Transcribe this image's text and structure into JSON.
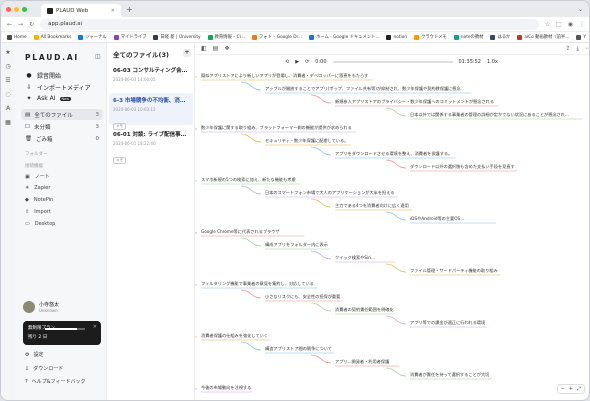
{
  "browser": {
    "tab_title": "PLAUD Web",
    "url": "app.plaud.ai",
    "bookmarks": [
      "Home",
      "All Bookmarks",
      "ジャーナル",
      "マイドライブ",
      "日経 新 | University",
      "教育情報 – Ci...",
      "フォト – Google Dr...",
      "ホーム - Google ドキュメント...",
      "notion",
      "クラウドメモ",
      "noteの教材",
      "はるか",
      "aiCo 動画教材（前半...",
      "Y",
      "小学生ボス",
      "Remote",
      "Amazon Photos",
      "ブログ Amazon Photos",
      "ニクアス Stu...",
      "LINE OA MANAGER",
      "確認ボタン登録"
    ],
    "bookmark_colors": [
      "#4a4a4a",
      "#f2b400",
      "#1a73e8",
      "#8e44ad",
      "#2c3e50",
      "#1aa260",
      "#e67e22",
      "#1a73e8",
      "#222222",
      "#ff9800",
      "#16a085",
      "#34495e",
      "#c0392b",
      "#555555",
      "#e74c3c",
      "#2980b9",
      "#f39c12",
      "#f39c12",
      "#27ae60",
      "#06c755",
      "#7f8c8d"
    ]
  },
  "sidebar": {
    "logo": "PLAUD.AI",
    "menu": [
      {
        "icon": "mic-icon",
        "glyph": "●",
        "label": "録音開始"
      },
      {
        "icon": "import-icon",
        "glyph": "⇩",
        "label": "インポートメディア"
      },
      {
        "icon": "ai-icon",
        "glyph": "✦",
        "label": "Ask AI",
        "badge": "New"
      }
    ],
    "nav": [
      {
        "icon": "file-icon",
        "glyph": "▤",
        "label": "全てのファイル",
        "count": "3",
        "active": true
      },
      {
        "icon": "uncategorized-icon",
        "glyph": "☐",
        "label": "未分類",
        "count": "3",
        "active": false
      },
      {
        "icon": "trash-icon",
        "glyph": "🗑",
        "label": "ごみ箱",
        "count": "0",
        "active": false
      }
    ],
    "folder_label": "フォルダー",
    "integration_label": "接続機能",
    "integrations": [
      {
        "icon": "note-icon",
        "glyph": "▣",
        "label": "ノート"
      },
      {
        "icon": "zapier-icon",
        "glyph": "✳",
        "label": "Zapier"
      },
      {
        "icon": "notepin-icon",
        "glyph": "◆",
        "label": "NotePin"
      },
      {
        "icon": "import-doc-icon",
        "glyph": "⇪",
        "label": "Import"
      },
      {
        "icon": "desktop-icon",
        "glyph": "▭",
        "label": "Desktop"
      }
    ],
    "user_name": "小寺悠太",
    "user_sub": "Unknown",
    "plan_line1": "無制限プラン",
    "plan_line2": "残り 2 日",
    "plan_progress": 0.8,
    "footer": [
      {
        "icon": "settings-icon",
        "glyph": "⚙",
        "label": "設定"
      },
      {
        "icon": "download-icon",
        "glyph": "⇩",
        "label": "ダウンロード"
      },
      {
        "icon": "help-icon",
        "glyph": "?",
        "label": "ヘルプ&フィードバック"
      }
    ]
  },
  "filelist": {
    "header": "全てのファイル(3)",
    "files": [
      {
        "title": "06-03 コンサルティング会議：アドバ...",
        "date": "2024-06-03 14:00:05",
        "tag": "メモ",
        "active": false
      },
      {
        "title": "6-3 市場競争の不均衡、消費者保護...",
        "date": "2024-06-03 10:03:12",
        "tag": "メモ",
        "active": true
      },
      {
        "title": "06-01 対談: ライブ配信事業の変遷...",
        "date": "2024-06-01 18:22:40",
        "tag": "メモ",
        "active": false
      }
    ]
  },
  "player": {
    "current": "0:00",
    "total": "01:35:52",
    "speed": "1.0x",
    "progress": 0.0
  },
  "mindmap": {
    "nodes": [
      "擬似アプリストアにより新しいアプリが登場し、消費者・デベロッパーに恩恵をもたらす",
      "アップルが開放することでアプリ(ポップ、ファイル共有等)が抑制され、数少年保護や契約教保護に懸念",
      "新規参入アプリストアのプライバシー・数少年保護へのコミットメントが懸念される",
      "日本以外では関係する事業者の管理の詳細が定かでない状況にあることが懸念され...",
      "数少年保護に関する取り組み、ブラットフォーマー側の機能が提供が求められる",
      "セキュリティ・数少年保護に配慮している。",
      "アプリをダウンロードさせる環境を整え、消費者を保護する。",
      "ダウンロード以外の選択肢も含めた支払い手段を見直す",
      "スマホ新規の5つの検索に加え、新たな機能も考慮",
      "日本のスマートフォン市場で大人のアプリケーションが大半を担える",
      "主力である4つを消費者向けに広く適用",
      "iOSやAndroid等の主要OS...",
      "Google Chrome等に代表されるブラウザ",
      "構成アプリをフォルダー内に表示",
      "クイック検索やSiri...",
      "ファイル管理・サードパーティ機能の取り組み",
      "フィルタリング機能で事業者の意見を集約し、対応している",
      "小さなリスクにも、安全性の担保が重要",
      "消費者の契約責任範囲を明確化",
      "アプリ等での課金が適正に行われる環境",
      "消費者保護の仕組みを強化していく",
      "構造アプリストア間の競争について",
      "アプリ...開発者・利用者保護",
      "消費者が責任を持って選択することが大切",
      "今後の市場動向を注視する"
    ]
  }
}
